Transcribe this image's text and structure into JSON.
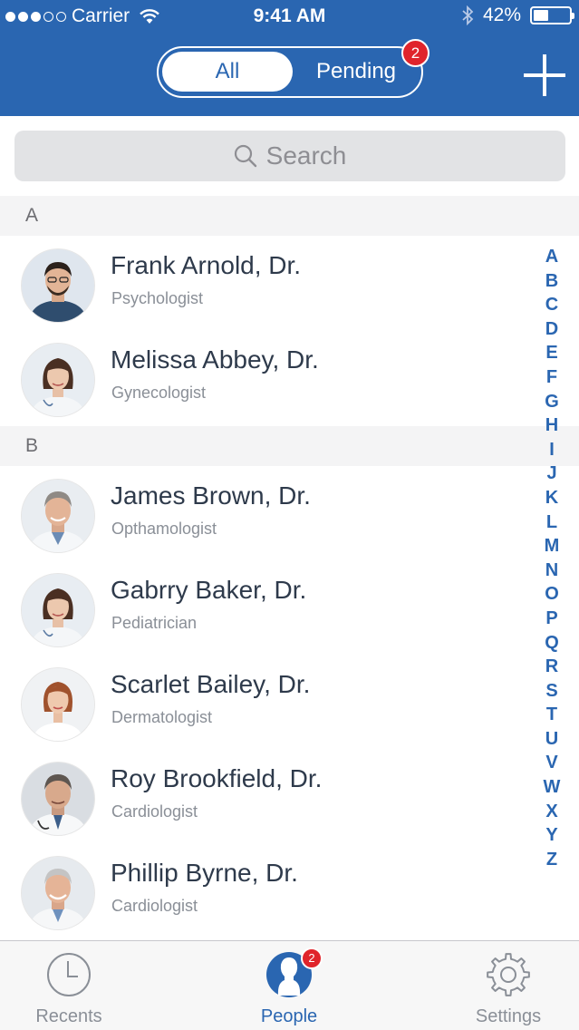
{
  "status_bar": {
    "carrier": "Carrier",
    "time": "9:41 AM",
    "battery": "42%",
    "battery_level": 0.42,
    "signal_bars_filled": 3,
    "signal_bars_total": 5
  },
  "header": {
    "tabs": [
      {
        "label": "All",
        "selected": true
      },
      {
        "label": "Pending",
        "selected": false
      }
    ],
    "pending_badge": "2",
    "add_icon": "plus-icon",
    "accent_color": "#2a66b1"
  },
  "search": {
    "placeholder": "Search",
    "icon": "search-icon"
  },
  "sections": [
    {
      "letter": "A",
      "contacts": [
        {
          "name": "Frank Arnold, Dr.",
          "specialty": "Psychologist"
        },
        {
          "name": "Melissa Abbey, Dr.",
          "specialty": "Gynecologist"
        }
      ]
    },
    {
      "letter": "B",
      "contacts": [
        {
          "name": "James Brown, Dr.",
          "specialty": "Opthamologist"
        },
        {
          "name": "Gabrry Baker, Dr.",
          "specialty": "Pediatrician"
        },
        {
          "name": "Scarlet Bailey, Dr.",
          "specialty": "Dermatologist"
        },
        {
          "name": "Roy Brookfield, Dr.",
          "specialty": "Cardiologist"
        },
        {
          "name": "Phillip Byrne, Dr.",
          "specialty": "Cardiologist"
        }
      ]
    }
  ],
  "alphabet_index": [
    "A",
    "B",
    "C",
    "D",
    "E",
    "F",
    "G",
    "H",
    "I",
    "J",
    "K",
    "L",
    "M",
    "N",
    "O",
    "P",
    "Q",
    "R",
    "S",
    "T",
    "U",
    "V",
    "W",
    "X",
    "Y",
    "Z"
  ],
  "tab_bar": {
    "items": [
      {
        "label": "Recents",
        "icon": "clock-icon",
        "active": false
      },
      {
        "label": "People",
        "icon": "person-icon",
        "active": true,
        "badge": "2"
      },
      {
        "label": "Settings",
        "icon": "gear-icon",
        "active": false
      }
    ]
  }
}
